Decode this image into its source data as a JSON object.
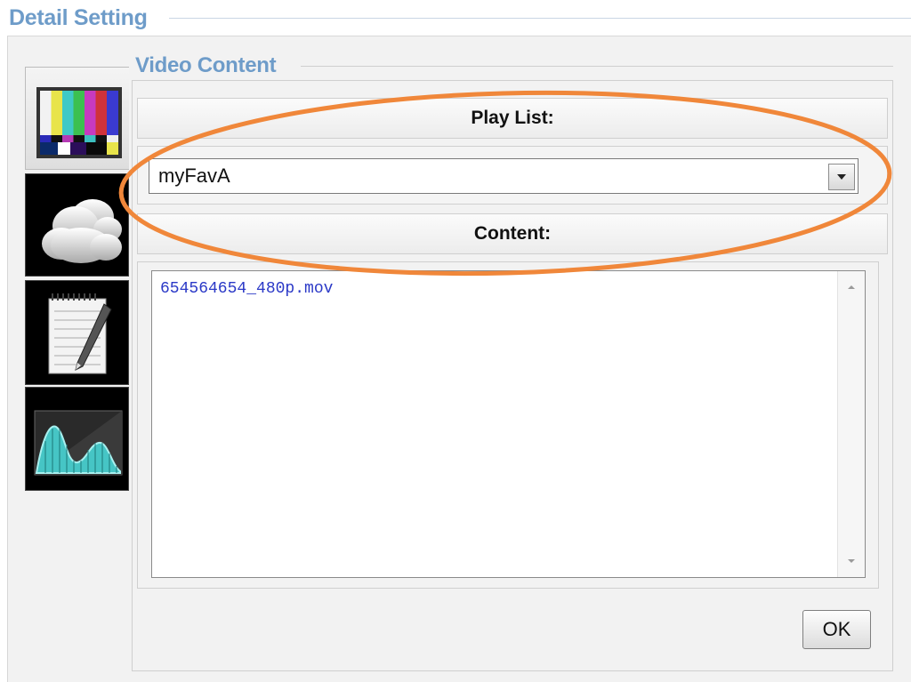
{
  "dialog": {
    "title": "Detail Setting",
    "section_title": "Video Content"
  },
  "sidebar": {
    "tabs": [
      {
        "name": "video-content",
        "icon": "color-bars-icon",
        "active": true
      },
      {
        "name": "weather",
        "icon": "cloud-icon",
        "active": false
      },
      {
        "name": "notes",
        "icon": "notepad-pen-icon",
        "active": false
      },
      {
        "name": "chart",
        "icon": "waveform-chart-icon",
        "active": false
      }
    ]
  },
  "playlist": {
    "label": "Play List:",
    "selected": "myFavA"
  },
  "content": {
    "label": "Content:",
    "items": [
      "654564654_480p.mov"
    ]
  },
  "buttons": {
    "ok_label": "OK"
  },
  "colors": {
    "legend": "#6e9cc9",
    "highlight": "#f0873a",
    "content_text": "#2b39c7"
  }
}
